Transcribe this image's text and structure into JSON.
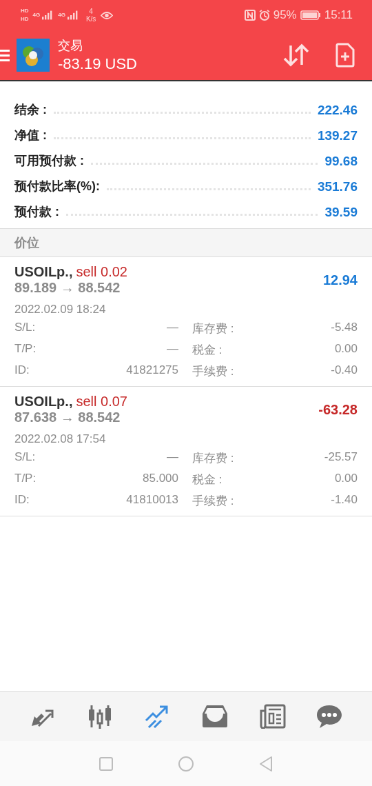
{
  "status_bar": {
    "sim_labels": [
      "HD",
      "HD"
    ],
    "network_labels": [
      "4G",
      "4G"
    ],
    "speed_value": "4",
    "speed_unit": "K/s",
    "battery": "95%",
    "time": "15:11"
  },
  "header": {
    "title": "交易",
    "balance": "-83.19 USD"
  },
  "summary": [
    {
      "label": "结余 :",
      "value": "222.46"
    },
    {
      "label": "净值 :",
      "value": "139.27"
    },
    {
      "label": "可用预付款 :",
      "value": "99.68"
    },
    {
      "label": "预付款比率(%):",
      "value": "351.76"
    },
    {
      "label": "预付款 :",
      "value": "39.59"
    }
  ],
  "section_title": "价位",
  "positions": [
    {
      "symbol": "USOILp.,",
      "side": "sell 0.02",
      "prices": "89.189 → 88.542",
      "profit": "12.94",
      "color": "#1a7bd6",
      "time": "2022.02.09 18:24",
      "sl": "—",
      "tp": "—",
      "id": "41821275",
      "swap_label": "库存费 :",
      "swap": "-5.48",
      "tax_label": "税金 :",
      "tax": "0.00",
      "fee_label": "手续费 :",
      "fee": "-0.40",
      "sl_label": "S/L:",
      "tp_label": "T/P:",
      "id_label": "ID:"
    },
    {
      "symbol": "USOILp.,",
      "side": "sell 0.07",
      "prices": "87.638 → 88.542",
      "profit": "-63.28",
      "color": "#c62828",
      "time": "2022.02.08 17:54",
      "sl": "—",
      "tp": "85.000",
      "id": "41810013",
      "swap_label": "库存费 :",
      "swap": "-25.57",
      "tax_label": "税金 :",
      "tax": "0.00",
      "fee_label": "手续费 :",
      "fee": "-1.40",
      "sl_label": "S/L:",
      "tp_label": "T/P:",
      "id_label": "ID:"
    }
  ],
  "bottom_nav": [
    {
      "kind": "quotes",
      "selected": false
    },
    {
      "kind": "chart",
      "selected": false
    },
    {
      "kind": "trade",
      "selected": true
    },
    {
      "kind": "history",
      "selected": false
    },
    {
      "kind": "news",
      "selected": false
    },
    {
      "kind": "chat",
      "selected": false
    }
  ]
}
